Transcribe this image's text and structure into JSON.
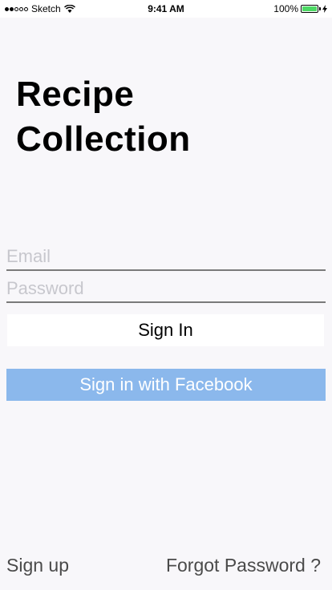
{
  "status_bar": {
    "carrier": "Sketch",
    "time": "9:41 AM",
    "battery_percent": "100%",
    "battery_level": 1.0,
    "battery_color": "#4cd964"
  },
  "title": {
    "line1": "Recipe",
    "line2": "Collection"
  },
  "form": {
    "email_placeholder": "Email",
    "email_value": "",
    "password_placeholder": "Password",
    "password_value": ""
  },
  "buttons": {
    "sign_in": "Sign In",
    "facebook": "Sign in with Facebook",
    "facebook_color": "#8bb8ec"
  },
  "footer": {
    "sign_up": "Sign up",
    "forgot_password": "Forgot Password ?"
  }
}
